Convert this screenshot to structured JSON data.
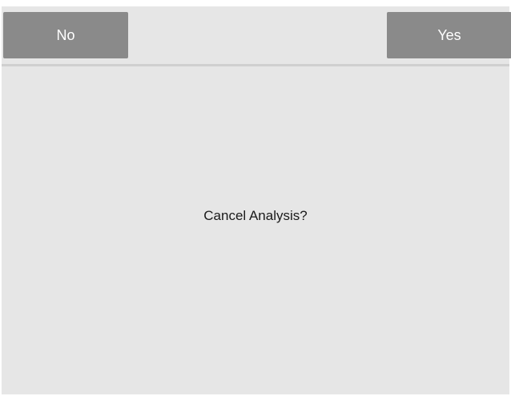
{
  "dialog": {
    "no_label": "No",
    "yes_label": "Yes",
    "message": "Cancel Analysis?"
  },
  "colors": {
    "panel_background": "#e6e6e6",
    "button_background": "#8a8a8a",
    "button_text": "#ffffff",
    "message_text": "#1a1a1a",
    "divider": "#cfcfcf"
  }
}
